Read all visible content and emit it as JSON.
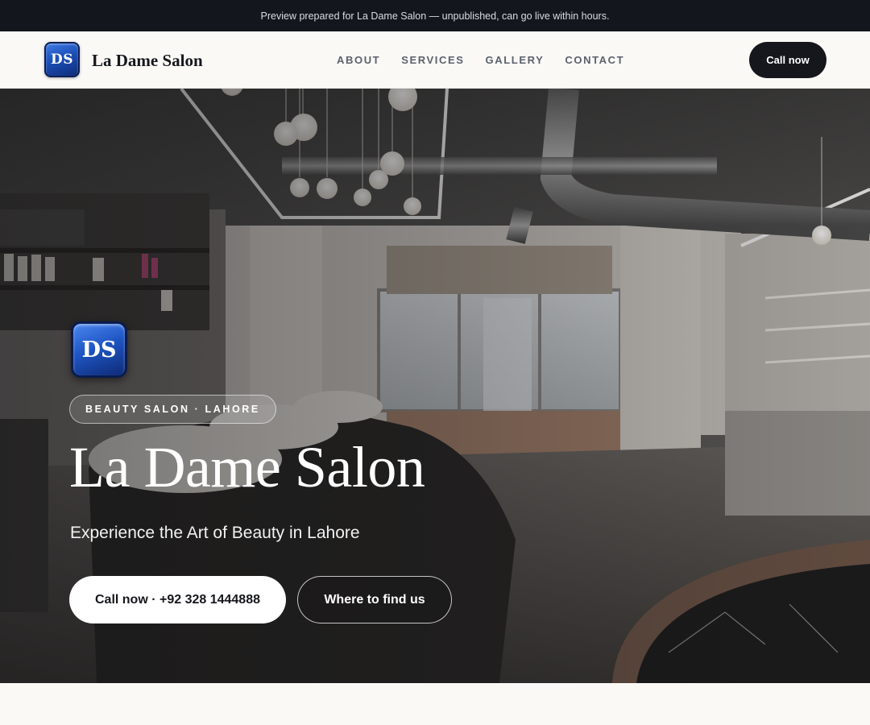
{
  "announcement": "Preview prepared for La Dame Salon — unpublished, can go live within hours.",
  "brand": {
    "initials": "DS",
    "name": "La Dame Salon"
  },
  "nav": {
    "links": [
      "ABOUT",
      "SERVICES",
      "GALLERY",
      "CONTACT"
    ],
    "cta": "Call now"
  },
  "hero": {
    "badge_initials": "DS",
    "tagline": "BEAUTY SALON · LAHORE",
    "title": "La Dame Salon",
    "subtitle": "Experience the Art of Beauty in Lahore",
    "primary_button": "Call now · +92 328 1444888",
    "secondary_button": "Where to find us"
  },
  "colors": {
    "dark": "#13161d",
    "accent_blue": "#1f56c4",
    "page_bg": "#faf9f6"
  }
}
